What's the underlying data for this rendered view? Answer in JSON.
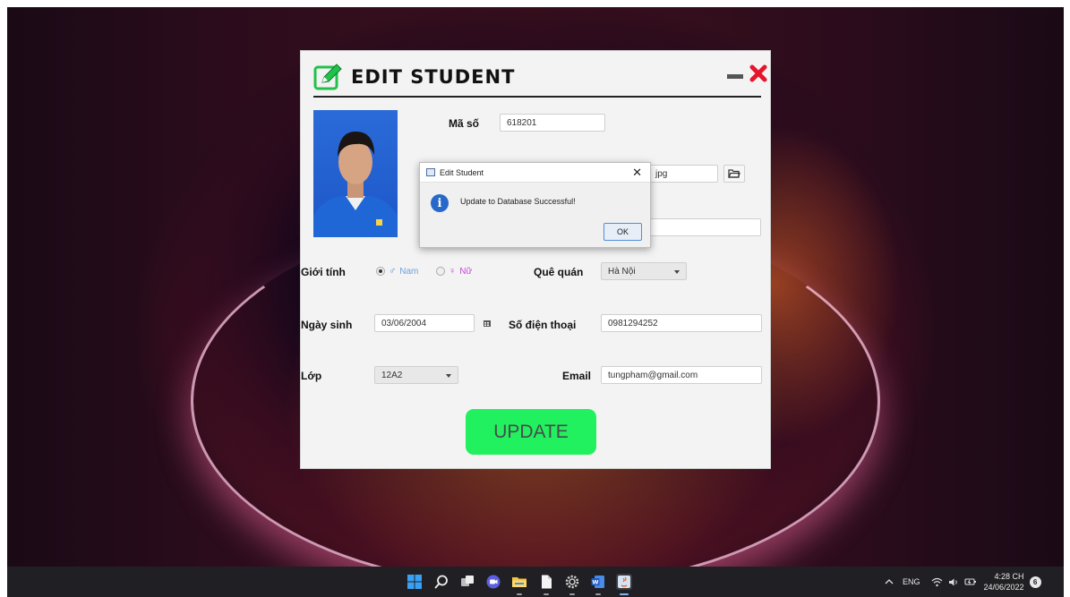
{
  "app": {
    "title": "EDIT STUDENT",
    "update_button": "UPDATE",
    "fields": {
      "ma_so": {
        "label": "Mã số",
        "value": "618201"
      },
      "image_path": {
        "value": "jpg"
      },
      "gioi_tinh": {
        "label": "Giới tính",
        "options": [
          "Nam",
          "Nữ"
        ],
        "selected": "Nam"
      },
      "que_quan": {
        "label": "Quê quán",
        "value": "Hà Nội"
      },
      "ngay_sinh": {
        "label": "Ngày sinh",
        "value": "03/06/2004"
      },
      "so_dien_thoai": {
        "label": "Số điện thoại",
        "value": "0981294252"
      },
      "lop": {
        "label": "Lớp",
        "value": "12A2"
      },
      "email": {
        "label": "Email",
        "value": "tungpham@gmail.com"
      }
    },
    "colors": {
      "accent": "#21f15f",
      "close": "#e5162b"
    }
  },
  "dialog": {
    "title": "Edit Student",
    "message": "Update to Database Successful!",
    "ok_label": "OK",
    "close_glyph": "✕"
  },
  "taskbar": {
    "icons": [
      "windows-start-icon",
      "search-icon",
      "task-view-icon",
      "chat-icon",
      "file-explorer-icon",
      "file-icon",
      "settings-icon",
      "word-icon",
      "java-app-icon"
    ],
    "tray": {
      "language": "ENG",
      "time": "4:28 CH",
      "date": "24/06/2022",
      "notification_count": "6"
    }
  }
}
